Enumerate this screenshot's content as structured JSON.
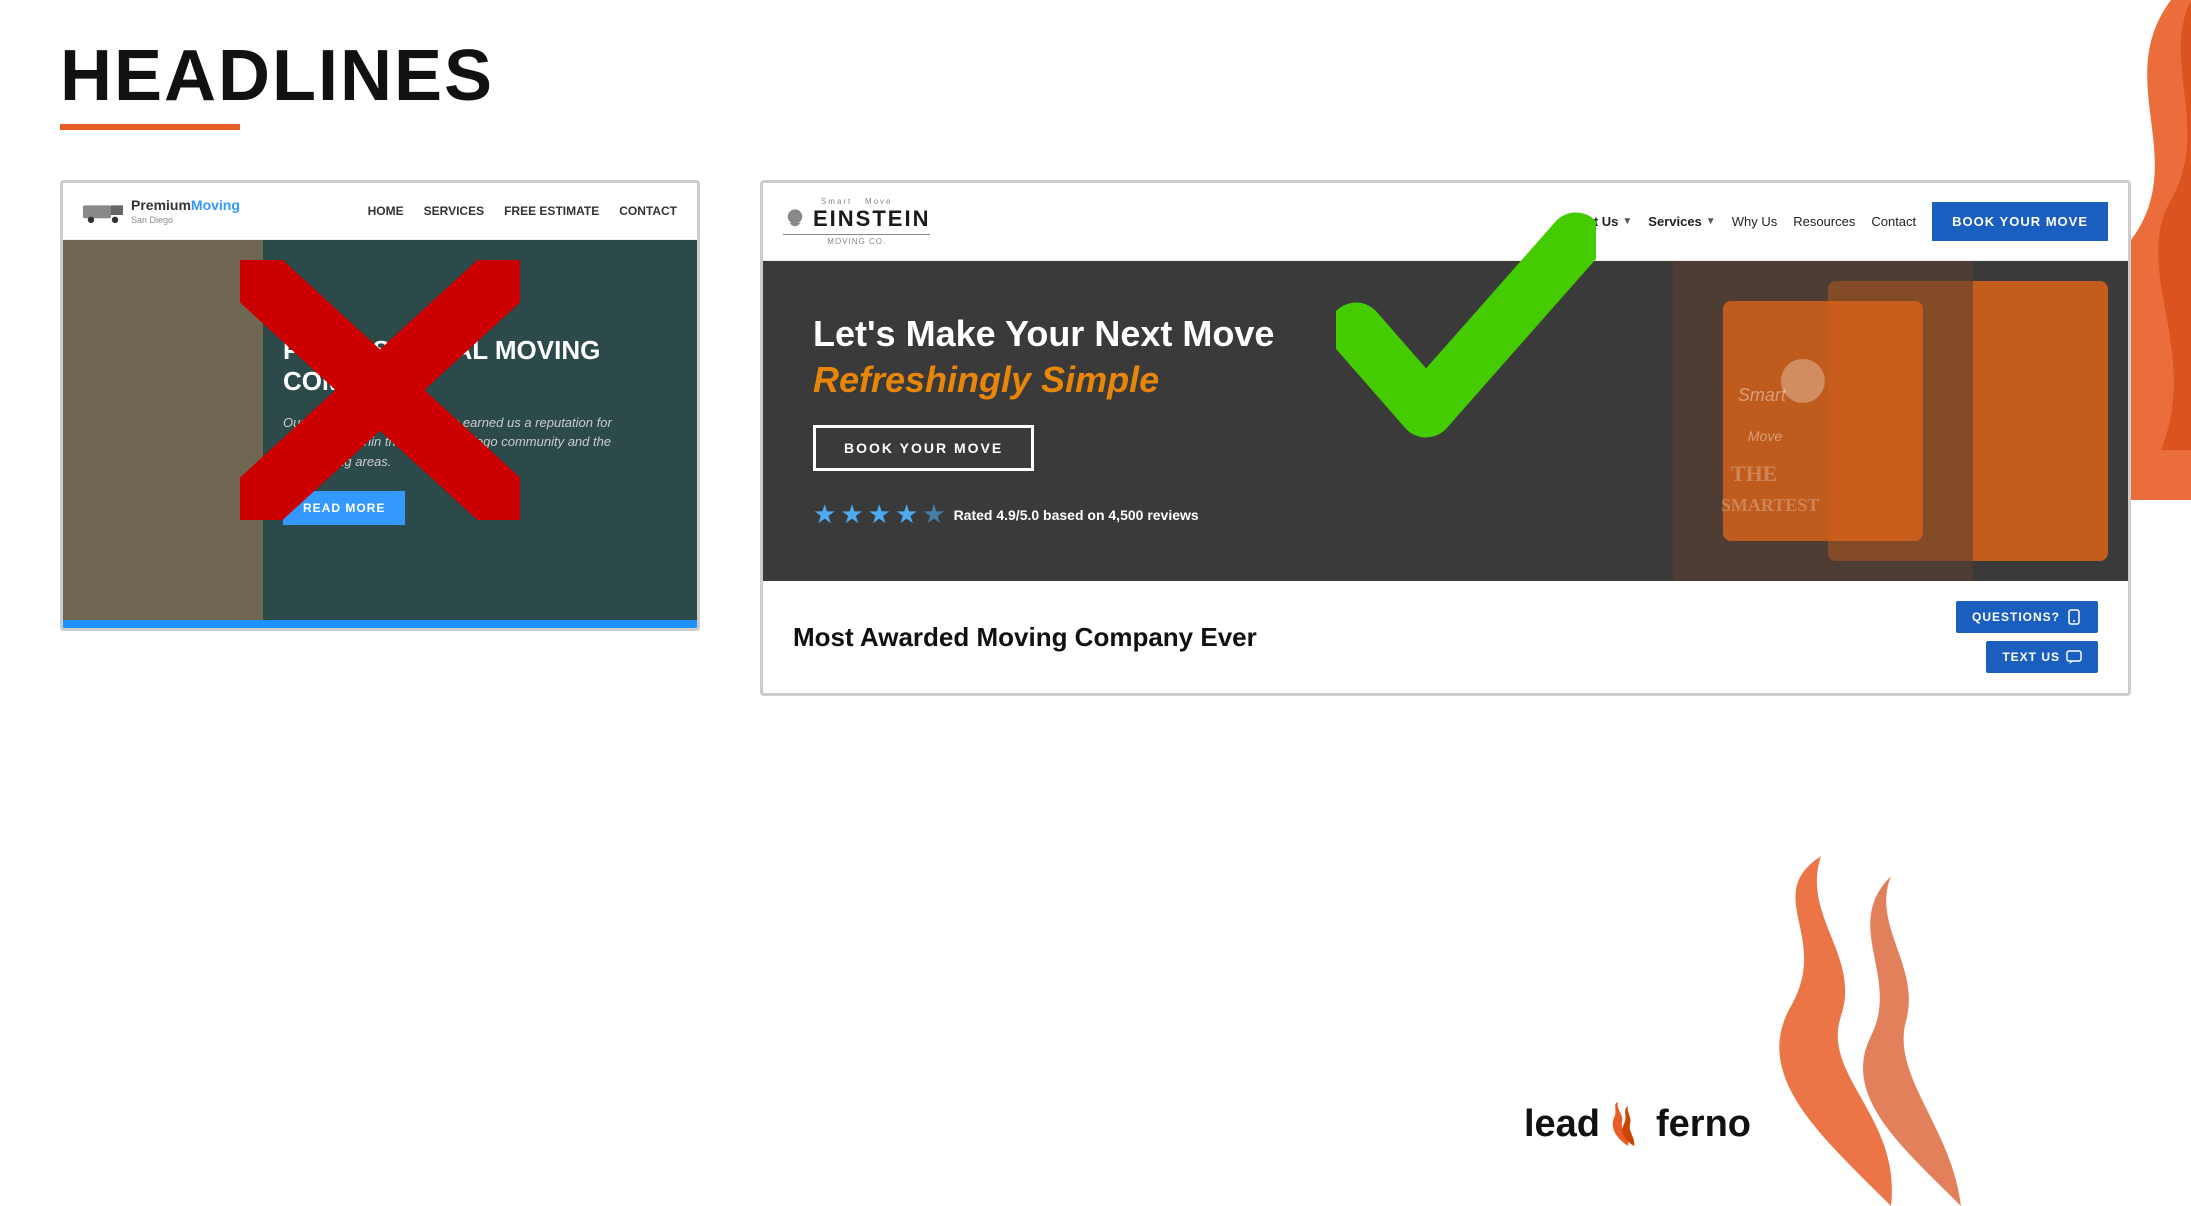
{
  "page": {
    "title": "HEADLINES",
    "title_underline_color": "#e85d26"
  },
  "bad_example": {
    "x_mark": "✕",
    "logo_text": "Premium",
    "logo_text_colored": "Moving",
    "logo_subtext": "San Diego",
    "nav_links": [
      "HOME",
      "SERVICES",
      "FREE ESTIMATE",
      "CONTACT"
    ],
    "hero_title": "PROFESSIONAL MOVING COMPANY.",
    "hero_desc": "Our commitment to quality has earned us a reputation for excellence within the local San Diego community and the surrounding areas.",
    "hero_btn": "READ MORE"
  },
  "good_example": {
    "check_mark": "✓",
    "logo_top": "Smart Move",
    "logo_main_part1": "EINSTEIN",
    "logo_main_part2": "",
    "logo_bottom": "MOVING CO.",
    "nav_about": "About Us",
    "nav_services": "Services",
    "nav_why_us": "Why Us",
    "nav_resources": "Resources",
    "nav_contact": "Contact",
    "nav_book_btn": "BOOK YOUR MOVE",
    "hero_title": "Let's Make Your Next Move",
    "hero_subtitle": "Refreshingly Simple",
    "hero_btn": "BOOK YOUR MOVE",
    "rating_text": "Rated 4.9/5.0 based on 4,500 reviews",
    "lower_title": "Most Awarded Moving Company Ever",
    "questions_btn": "QUESTIONS?",
    "text_us_btn": "TEXT US"
  },
  "branding": {
    "leadferno": "lead",
    "leadferno2": "ferno",
    "flame_color": "#e85d26",
    "accent_blue": "#1a5fbf",
    "accent_orange": "#e8860a"
  }
}
